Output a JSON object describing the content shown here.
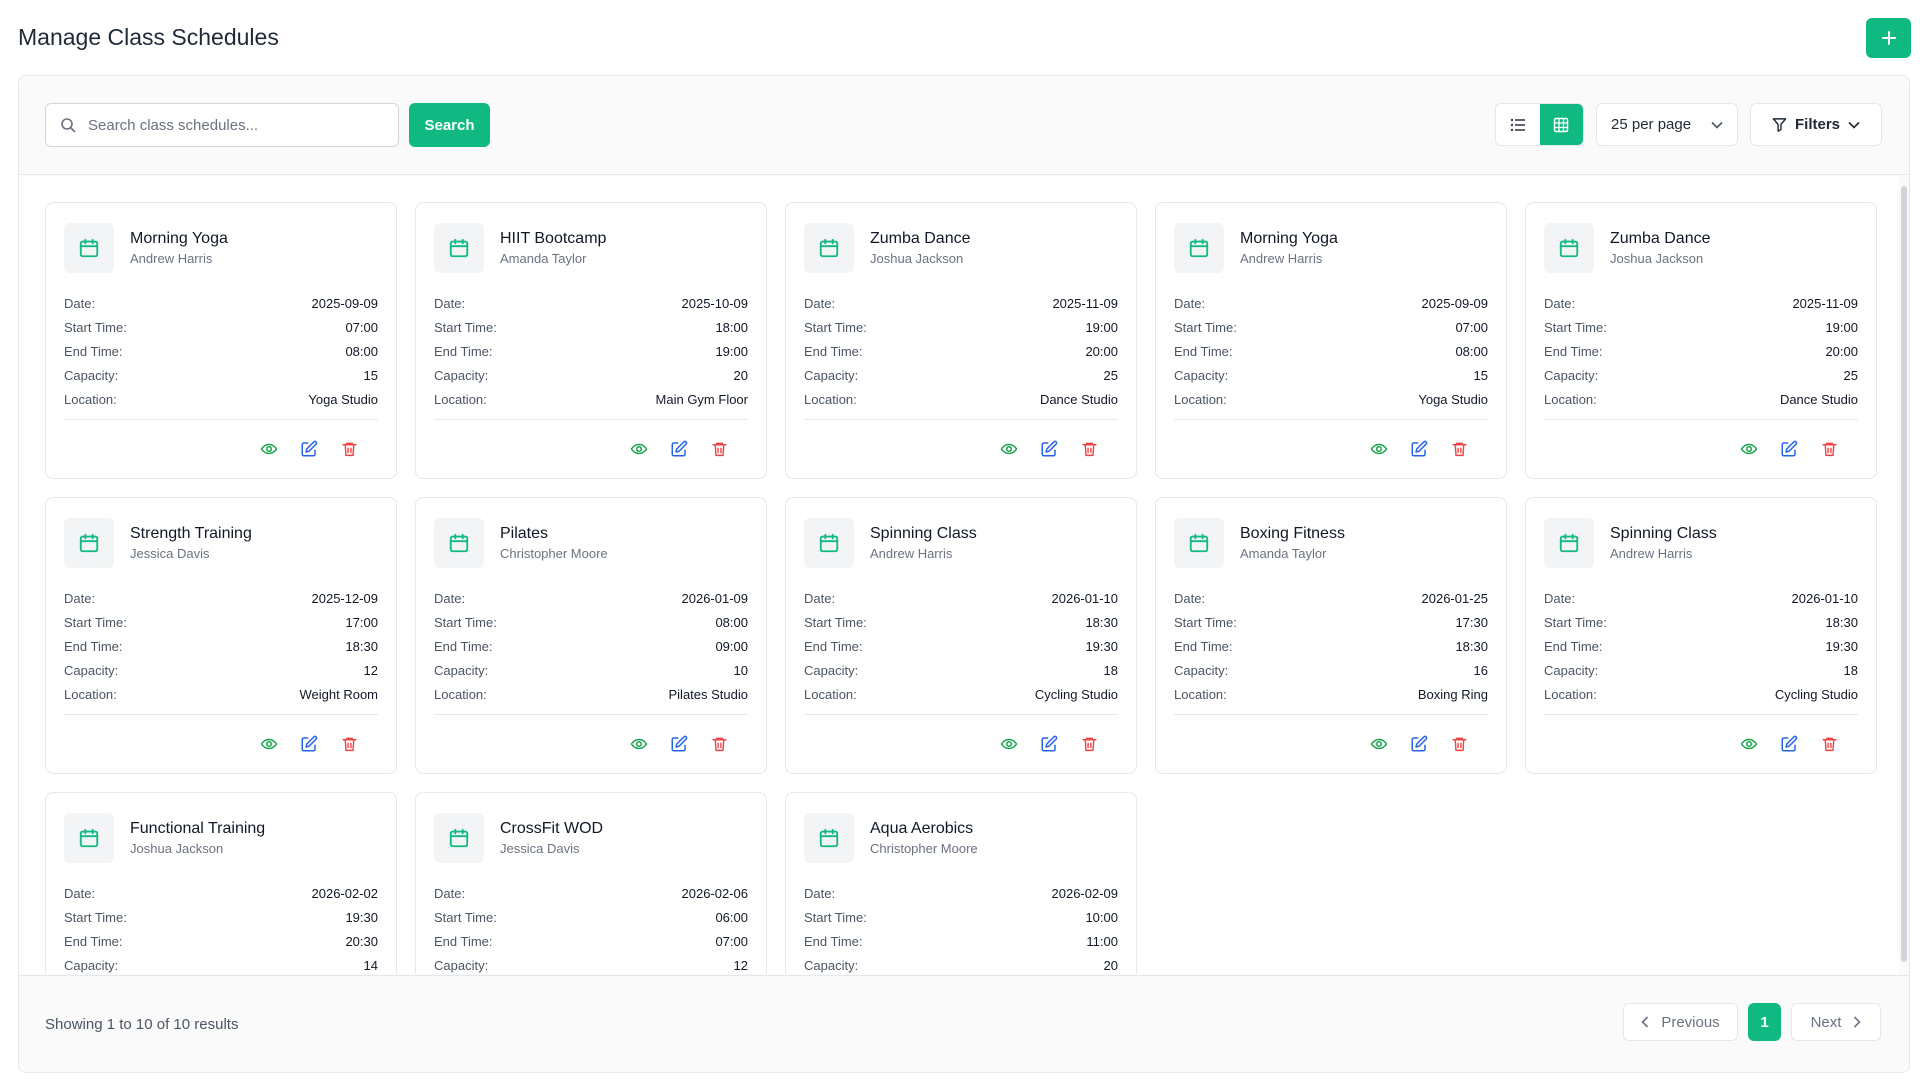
{
  "header": {
    "title": "Manage Class Schedules",
    "add_icon": "plus-icon"
  },
  "toolbar": {
    "search_placeholder": "Search class schedules...",
    "search_value": "",
    "search_label": "Search",
    "view_modes": [
      "list-icon",
      "grid-icon"
    ],
    "active_view": "grid",
    "per_page": "25 per page",
    "filters_label": "Filters"
  },
  "labels": {
    "date": "Date:",
    "start_time": "Start Time:",
    "end_time": "End Time:",
    "capacity": "Capacity:",
    "location": "Location:"
  },
  "colors": {
    "accent": "#10b981",
    "view": "#16a34a",
    "edit": "#2563eb",
    "delete": "#ef4444"
  },
  "schedules": [
    {
      "name": "Morning Yoga",
      "instructor": "Andrew Harris",
      "date": "2025-09-09",
      "start": "07:00",
      "end": "08:00",
      "capacity": "15",
      "location": "Yoga Studio"
    },
    {
      "name": "HIIT Bootcamp",
      "instructor": "Amanda Taylor",
      "date": "2025-10-09",
      "start": "18:00",
      "end": "19:00",
      "capacity": "20",
      "location": "Main Gym Floor"
    },
    {
      "name": "Zumba Dance",
      "instructor": "Joshua Jackson",
      "date": "2025-11-09",
      "start": "19:00",
      "end": "20:00",
      "capacity": "25",
      "location": "Dance Studio"
    },
    {
      "name": "Morning Yoga",
      "instructor": "Andrew Harris",
      "date": "2025-09-09",
      "start": "07:00",
      "end": "08:00",
      "capacity": "15",
      "location": "Yoga Studio"
    },
    {
      "name": "Zumba Dance",
      "instructor": "Joshua Jackson",
      "date": "2025-11-09",
      "start": "19:00",
      "end": "20:00",
      "capacity": "25",
      "location": "Dance Studio"
    },
    {
      "name": "Strength Training",
      "instructor": "Jessica Davis",
      "date": "2025-12-09",
      "start": "17:00",
      "end": "18:30",
      "capacity": "12",
      "location": "Weight Room"
    },
    {
      "name": "Pilates",
      "instructor": "Christopher Moore",
      "date": "2026-01-09",
      "start": "08:00",
      "end": "09:00",
      "capacity": "10",
      "location": "Pilates Studio"
    },
    {
      "name": "Spinning Class",
      "instructor": "Andrew Harris",
      "date": "2026-01-10",
      "start": "18:30",
      "end": "19:30",
      "capacity": "18",
      "location": "Cycling Studio"
    },
    {
      "name": "Boxing Fitness",
      "instructor": "Amanda Taylor",
      "date": "2026-01-25",
      "start": "17:30",
      "end": "18:30",
      "capacity": "16",
      "location": "Boxing Ring"
    },
    {
      "name": "Spinning Class",
      "instructor": "Andrew Harris",
      "date": "2026-01-10",
      "start": "18:30",
      "end": "19:30",
      "capacity": "18",
      "location": "Cycling Studio"
    },
    {
      "name": "Functional Training",
      "instructor": "Joshua Jackson",
      "date": "2026-02-02",
      "start": "19:30",
      "end": "20:30",
      "capacity": "14",
      "location": ""
    },
    {
      "name": "CrossFit WOD",
      "instructor": "Jessica Davis",
      "date": "2026-02-06",
      "start": "06:00",
      "end": "07:00",
      "capacity": "12",
      "location": ""
    },
    {
      "name": "Aqua Aerobics",
      "instructor": "Christopher Moore",
      "date": "2026-02-09",
      "start": "10:00",
      "end": "11:00",
      "capacity": "20",
      "location": ""
    }
  ],
  "footer": {
    "showing_text": "Showing 1 to 10 of 10 results",
    "prev_label": "Previous",
    "current_page": "1",
    "next_label": "Next"
  }
}
